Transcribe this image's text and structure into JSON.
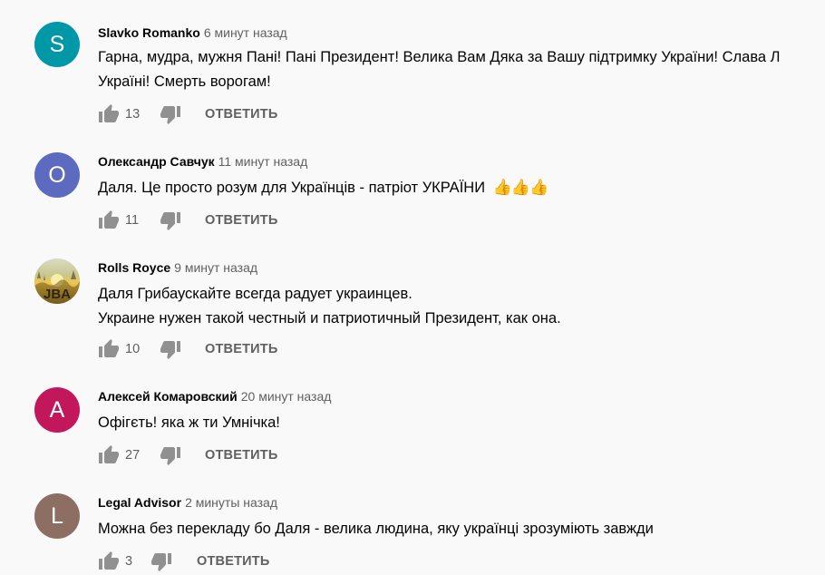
{
  "reply_label": "ОТВЕТИТЬ",
  "comments": [
    {
      "author": "Slavko Romanko",
      "time": "6 минут назад",
      "text": "Гарна, мудра, мужня Пані! Пані Президент! Велика Вам Дяка за Вашу підтримку України! Слава Л\nУкраїні! Смерть ворогам!",
      "likes": "13",
      "avatar_letter": "S",
      "avatar_color": "#0097a7"
    },
    {
      "author": "Олександр Савчук",
      "time": "11 минут назад",
      "text": "Даля. Це просто  розум  для Українців - патріот УКРАЇНИ ",
      "emoji": "👍👍👍",
      "likes": "11",
      "avatar_letter": "O",
      "avatar_color": "#5c6bc0"
    },
    {
      "author": "Rolls Royce",
      "time": "9 минут назад",
      "text": "Даля Грибаускайте всегда радует украинцев.\nУкраине нужен такой честный и патриотичный Президент, как она.",
      "likes": "10",
      "avatar_logo": "JBA"
    },
    {
      "author": "Алексей Комаровский",
      "time": "20 минут назад",
      "text": "Офігєть! яка ж ти Умнічка!",
      "likes": "27",
      "avatar_letter": "A",
      "avatar_color": "#c2185b"
    },
    {
      "author": "Legal Advisor",
      "time": "2 минуты назад",
      "text": "Можна без перекладу бо Даля - велика людина, яку українці зрозуміють завжди",
      "likes": "3",
      "avatar_letter": "L",
      "avatar_color": "#8d6e63"
    }
  ],
  "icons": {
    "like": "thumb-up-icon",
    "dislike": "thumb-down-icon"
  }
}
